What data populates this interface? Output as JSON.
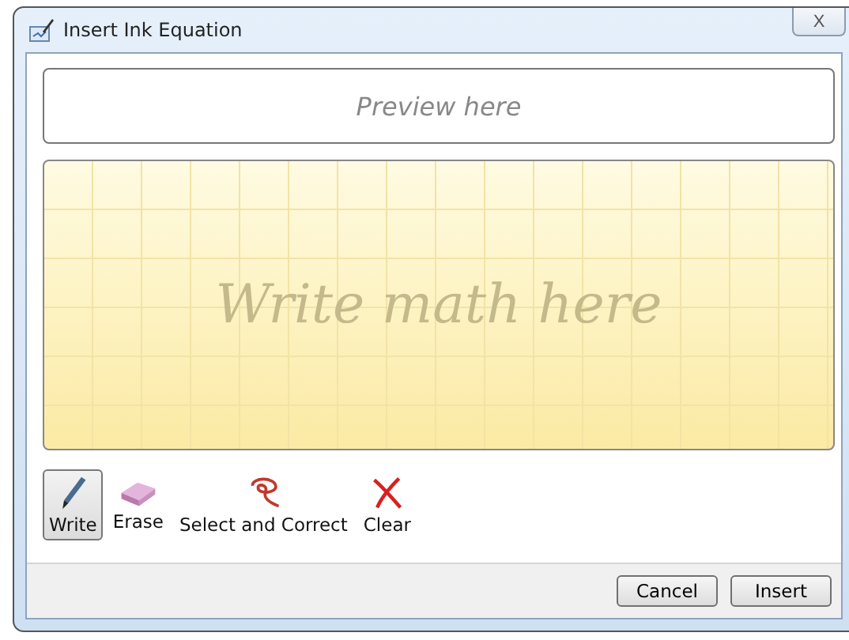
{
  "window": {
    "title": "Insert Ink Equation",
    "close": "X"
  },
  "preview": {
    "placeholder": "Preview here"
  },
  "canvas": {
    "placeholder": "Write math here"
  },
  "tools": [
    {
      "kind": "write",
      "label": "Write",
      "selected": true
    },
    {
      "kind": "erase",
      "label": "Erase",
      "selected": false
    },
    {
      "kind": "select",
      "label": "Select and Correct",
      "selected": false
    },
    {
      "kind": "clear",
      "label": "Clear",
      "selected": false
    }
  ],
  "buttons": [
    "Cancel",
    "Insert"
  ]
}
